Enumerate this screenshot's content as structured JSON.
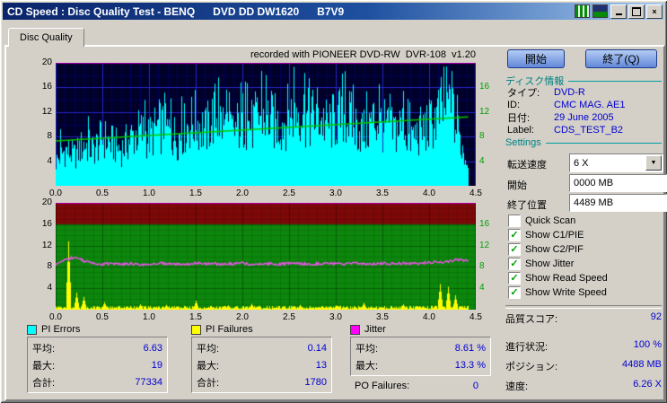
{
  "window": {
    "title": "CD Speed : Disc Quality Test - BENQ      DVD DD DW1620      B7V9"
  },
  "tab": {
    "label": "Disc Quality"
  },
  "chart_header": "recorded with PIONEER DVD-RW  DVR-108  v1.20",
  "buttons": {
    "start": "開始",
    "exit": "終了(Q)"
  },
  "disc_info": {
    "header": "ディスク情報",
    "rows": [
      {
        "label": "タイプ:",
        "value": "DVD-R"
      },
      {
        "label": "ID:",
        "value": "CMC MAG. AE1"
      },
      {
        "label": "日付:",
        "value": "29 June 2005"
      },
      {
        "label": "Label:",
        "value": "CDS_TEST_B2"
      }
    ]
  },
  "settings": {
    "header": "Settings",
    "speed_label": "転送速度",
    "speed_value": "6 X",
    "start_label": "開始",
    "start_value": "0000 MB",
    "end_label": "終了位置",
    "end_value": "4489 MB",
    "checkboxes": [
      {
        "label": "Quick Scan",
        "checked": false
      },
      {
        "label": "Show C1/PIE",
        "checked": true
      },
      {
        "label": "Show C2/PIF",
        "checked": true
      },
      {
        "label": "Show Jitter",
        "checked": true
      },
      {
        "label": "Show Read Speed",
        "checked": true
      },
      {
        "label": "Show Write Speed",
        "checked": true
      }
    ]
  },
  "score": {
    "label": "品質スコア:",
    "value": "92"
  },
  "status": [
    {
      "label": "進行状況:",
      "value": "100 %"
    },
    {
      "label": "ポジション:",
      "value": "4488 MB"
    },
    {
      "label": "速度:",
      "value": "6.26 X"
    }
  ],
  "stats_panels": [
    {
      "title": "PI Errors",
      "swatch": "#00ffff",
      "rows": [
        {
          "label": "平均:",
          "value": "6.63"
        },
        {
          "label": "最大:",
          "value": "19"
        },
        {
          "label": "合計:",
          "value": "77334"
        }
      ]
    },
    {
      "title": "PI Failures",
      "swatch": "#ffff00",
      "rows": [
        {
          "label": "平均:",
          "value": "0.14"
        },
        {
          "label": "最大:",
          "value": "13"
        },
        {
          "label": "合計:",
          "value": "1780"
        }
      ]
    },
    {
      "title": "Jitter",
      "swatch": "#ff00ff",
      "rows": [
        {
          "label": "平均:",
          "value": "8.61 %"
        },
        {
          "label": "最大:",
          "value": "13.3 %"
        }
      ],
      "extra": {
        "label": "PO Failures:",
        "value": "0"
      }
    }
  ],
  "chart_data": [
    {
      "id": "pi_errors",
      "type": "area",
      "title": "PI Errors vs disc position (GB)",
      "header": "recorded with PIONEER DVD-RW  DVR-108  v1.20",
      "xlim": [
        0,
        4.5
      ],
      "ylim": [
        0,
        20
      ],
      "x_ticks": [
        "0.0",
        "0.5",
        "1.0",
        "1.5",
        "2.0",
        "2.5",
        "3.0",
        "3.5",
        "4.0",
        "4.5"
      ],
      "y_ticks_left": [
        20,
        16,
        12,
        8,
        4
      ],
      "y_ticks_right": [
        16,
        12,
        8,
        4
      ],
      "bg_color": "#000028",
      "grid_minor": "#00005e",
      "grid_major": "#2626c4",
      "top_line_color": "#b400b4",
      "series": [
        {
          "name": "PI Errors",
          "color": "#00ffff",
          "style": "noisy_columns",
          "x_step": 0.1,
          "x_end": 4.42,
          "noise": 0.95,
          "values": [
            4,
            6,
            5,
            7,
            6,
            8,
            7,
            6,
            8,
            9,
            8,
            10,
            9,
            8,
            10,
            11,
            9,
            12,
            10,
            9,
            11,
            10,
            12,
            11,
            10,
            12,
            13,
            11,
            12,
            10,
            11,
            12,
            10,
            9,
            11,
            10,
            9,
            10,
            8,
            9,
            10,
            12,
            14,
            9,
            4
          ],
          "stats": {
            "average": 6.63,
            "maximum": 19,
            "total": 77334
          }
        },
        {
          "name": "Write Speed",
          "color": "#00c800",
          "style": "line",
          "points": [
            [
              0,
              7.3
            ],
            [
              4.42,
              11.2
            ]
          ]
        }
      ]
    },
    {
      "id": "pif_jitter",
      "type": "line",
      "title": "PI Failures and Jitter vs disc position (GB)",
      "xlim": [
        0,
        4.5
      ],
      "ylim": [
        0,
        20
      ],
      "x_ticks": [
        "0.0",
        "0.5",
        "1.0",
        "1.5",
        "2.0",
        "2.5",
        "3.0",
        "3.5",
        "4.0",
        "4.5"
      ],
      "y_ticks_left": [
        20,
        16,
        12,
        8,
        4
      ],
      "y_ticks_right": [
        16,
        12,
        8,
        4
      ],
      "bg_color": "#0c860c",
      "band": {
        "from": 16,
        "to": 20,
        "color": "#7c0808"
      },
      "top_line_color": "#b400b4",
      "series": [
        {
          "name": "PI Failures",
          "color": "#ffff00",
          "style": "spikes",
          "x_end": 4.42,
          "baseline": 0.6,
          "spikes": [
            [
              0.13,
              12.8
            ],
            [
              0.22,
              3.2
            ],
            [
              0.3,
              2.4
            ],
            [
              0.52,
              1.4
            ],
            [
              0.9,
              1.0
            ],
            [
              1.18,
              0.9
            ],
            [
              1.5,
              1.7
            ],
            [
              1.85,
              0.8
            ],
            [
              2.1,
              1.1
            ],
            [
              2.62,
              0.9
            ],
            [
              3.0,
              0.8
            ],
            [
              3.3,
              1.3
            ],
            [
              3.72,
              1.0
            ],
            [
              4.12,
              4.8
            ],
            [
              4.2,
              4.3
            ],
            [
              4.28,
              2.7
            ]
          ],
          "stats": {
            "average": 0.14,
            "maximum": 13,
            "total": 1780
          }
        },
        {
          "name": "Jitter",
          "color": "#f050f0",
          "style": "noisy_line",
          "x_step": 0.1,
          "x_end": 4.42,
          "noise": 0.5,
          "values": [
            8.4,
            9.3,
            9.9,
            9.1,
            8.6,
            8.5,
            8.7,
            8.5,
            8.6,
            8.4,
            8.5,
            8.7,
            8.6,
            8.5,
            8.6,
            8.7,
            8.5,
            8.6,
            8.5,
            8.6,
            8.7,
            8.5,
            8.6,
            8.6,
            8.5,
            8.7,
            8.6,
            8.5,
            8.6,
            8.7,
            8.6,
            8.5,
            8.7,
            8.6,
            8.6,
            8.7,
            8.6,
            8.7,
            8.6,
            8.7,
            8.8,
            8.9,
            9.0,
            9.4,
            9.1
          ],
          "stats": {
            "average_pct": 8.61,
            "maximum_pct": 13.3
          }
        }
      ],
      "po_failures": 0
    }
  ]
}
